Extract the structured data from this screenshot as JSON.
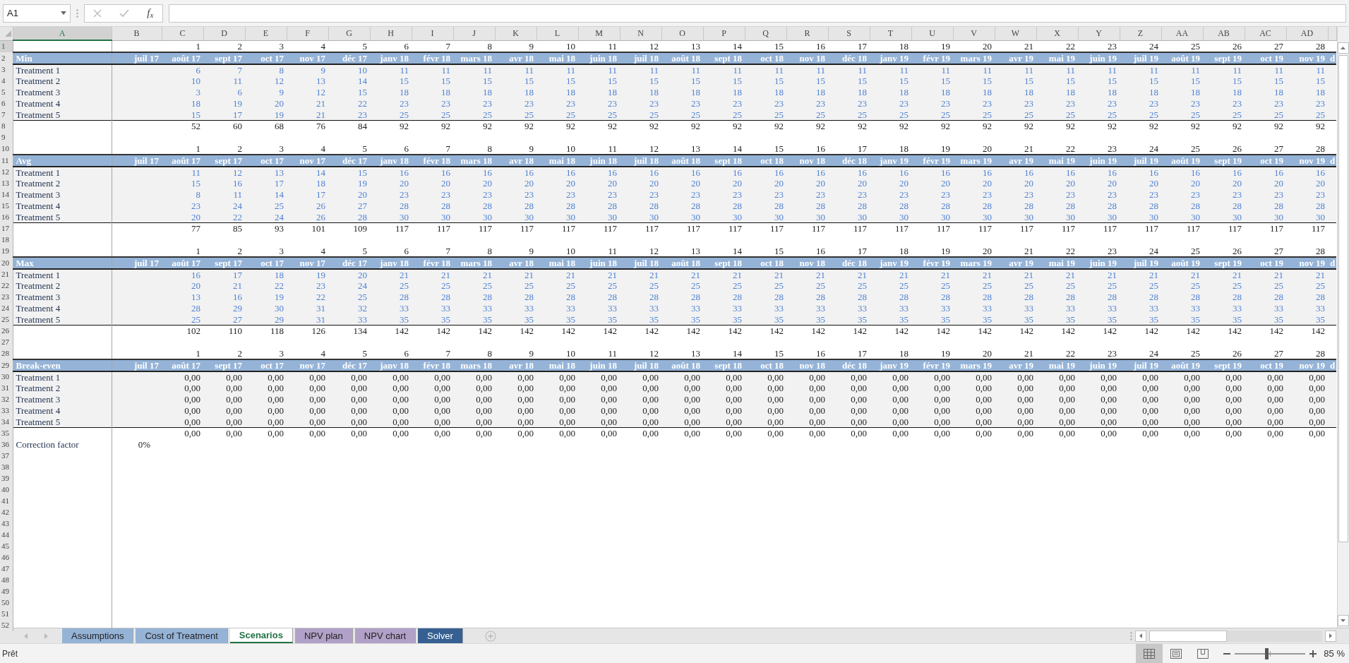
{
  "name_box": {
    "value": "A1"
  },
  "formula_bar": {
    "function_label": "f$_{x}$"
  },
  "column_headers": [
    {
      "label": "A",
      "selected": true
    },
    {
      "label": "B",
      "selected": false
    },
    {
      "label": "C",
      "selected": false
    },
    {
      "label": "D",
      "selected": false
    },
    {
      "label": "E",
      "selected": false
    },
    {
      "label": "F",
      "selected": false
    },
    {
      "label": "G",
      "selected": false
    },
    {
      "label": "H",
      "selected": false
    },
    {
      "label": "I",
      "selected": false
    },
    {
      "label": "J",
      "selected": false
    },
    {
      "label": "K",
      "selected": false
    },
    {
      "label": "L",
      "selected": false
    },
    {
      "label": "M",
      "selected": false
    },
    {
      "label": "N",
      "selected": false
    },
    {
      "label": "O",
      "selected": false
    },
    {
      "label": "P",
      "selected": false
    },
    {
      "label": "Q",
      "selected": false
    },
    {
      "label": "R",
      "selected": false
    },
    {
      "label": "S",
      "selected": false
    },
    {
      "label": "T",
      "selected": false
    },
    {
      "label": "U",
      "selected": false
    },
    {
      "label": "V",
      "selected": false
    },
    {
      "label": "W",
      "selected": false
    },
    {
      "label": "X",
      "selected": false
    },
    {
      "label": "Y",
      "selected": false
    },
    {
      "label": "Z",
      "selected": false
    },
    {
      "label": "AA",
      "selected": false
    },
    {
      "label": "AB",
      "selected": false
    },
    {
      "label": "AC",
      "selected": false
    },
    {
      "label": "AD",
      "selected": false
    }
  ],
  "row_headers": [
    {
      "label": "1",
      "selected": true
    },
    {
      "label": "2",
      "selected": false
    },
    {
      "label": "3",
      "selected": false
    },
    {
      "label": "4",
      "selected": false
    },
    {
      "label": "5",
      "selected": false
    },
    {
      "label": "6",
      "selected": false
    },
    {
      "label": "7",
      "selected": false
    },
    {
      "label": "8",
      "selected": false
    },
    {
      "label": "9",
      "selected": false
    },
    {
      "label": "10",
      "selected": false
    },
    {
      "label": "11",
      "selected": false
    },
    {
      "label": "12",
      "selected": false
    },
    {
      "label": "13",
      "selected": false
    },
    {
      "label": "14",
      "selected": false
    },
    {
      "label": "15",
      "selected": false
    },
    {
      "label": "16",
      "selected": false
    },
    {
      "label": "17",
      "selected": false
    },
    {
      "label": "18",
      "selected": false
    },
    {
      "label": "19",
      "selected": false
    },
    {
      "label": "20",
      "selected": false
    },
    {
      "label": "21",
      "selected": false
    },
    {
      "label": "22",
      "selected": false
    },
    {
      "label": "23",
      "selected": false
    },
    {
      "label": "24",
      "selected": false
    },
    {
      "label": "25",
      "selected": false
    },
    {
      "label": "26",
      "selected": false
    },
    {
      "label": "27",
      "selected": false
    },
    {
      "label": "28",
      "selected": false
    },
    {
      "label": "29",
      "selected": false
    },
    {
      "label": "30",
      "selected": false
    },
    {
      "label": "31",
      "selected": false
    },
    {
      "label": "32",
      "selected": false
    },
    {
      "label": "33",
      "selected": false
    },
    {
      "label": "34",
      "selected": false
    },
    {
      "label": "35",
      "selected": false
    },
    {
      "label": "36",
      "selected": false
    },
    {
      "label": "37",
      "selected": false
    },
    {
      "label": "38",
      "selected": false
    },
    {
      "label": "39",
      "selected": false
    },
    {
      "label": "40",
      "selected": false
    },
    {
      "label": "41",
      "selected": false
    },
    {
      "label": "42",
      "selected": false
    },
    {
      "label": "43",
      "selected": false
    },
    {
      "label": "44",
      "selected": false
    },
    {
      "label": "45",
      "selected": false
    },
    {
      "label": "46",
      "selected": false
    },
    {
      "label": "47",
      "selected": false
    },
    {
      "label": "48",
      "selected": false
    },
    {
      "label": "49",
      "selected": false
    },
    {
      "label": "50",
      "selected": false
    },
    {
      "label": "51",
      "selected": false
    },
    {
      "label": "52",
      "selected": false
    }
  ],
  "blocks": [
    {
      "label": "Min",
      "kind": "input",
      "index": [
        "1",
        "2",
        "3",
        "4",
        "5",
        "6",
        "7",
        "8",
        "9",
        "10",
        "11",
        "12",
        "13",
        "14",
        "15",
        "16",
        "17",
        "18",
        "19",
        "20",
        "21",
        "22",
        "23",
        "24",
        "25",
        "26",
        "27",
        "28"
      ],
      "months": [
        "juil 17",
        "août 17",
        "sept 17",
        "oct 17",
        "nov 17",
        "déc 17",
        "janv 18",
        "févr 18",
        "mars 18",
        "avr 18",
        "mai 18",
        "juin 18",
        "juil 18",
        "août 18",
        "sept 18",
        "oct 18",
        "nov 18",
        "déc 18",
        "janv 19",
        "févr 19",
        "mars 19",
        "avr 19",
        "mai 19",
        "juin 19",
        "juil 19",
        "août 19",
        "sept 19",
        "oct 19",
        "nov 19",
        "d"
      ],
      "rows": [
        {
          "label": "Treatment 1",
          "values": [
            "6",
            "7",
            "8",
            "9",
            "10",
            "11",
            "11",
            "11",
            "11",
            "11",
            "11",
            "11",
            "11",
            "11",
            "11",
            "11",
            "11",
            "11",
            "11",
            "11",
            "11",
            "11",
            "11",
            "11",
            "11",
            "11",
            "11",
            "11"
          ]
        },
        {
          "label": "Treatment 2",
          "values": [
            "10",
            "11",
            "12",
            "13",
            "14",
            "15",
            "15",
            "15",
            "15",
            "15",
            "15",
            "15",
            "15",
            "15",
            "15",
            "15",
            "15",
            "15",
            "15",
            "15",
            "15",
            "15",
            "15",
            "15",
            "15",
            "15",
            "15",
            "15"
          ]
        },
        {
          "label": "Treatment 3",
          "values": [
            "3",
            "6",
            "9",
            "12",
            "15",
            "18",
            "18",
            "18",
            "18",
            "18",
            "18",
            "18",
            "18",
            "18",
            "18",
            "18",
            "18",
            "18",
            "18",
            "18",
            "18",
            "18",
            "18",
            "18",
            "18",
            "18",
            "18",
            "18"
          ]
        },
        {
          "label": "Treatment 4",
          "values": [
            "18",
            "19",
            "20",
            "21",
            "22",
            "23",
            "23",
            "23",
            "23",
            "23",
            "23",
            "23",
            "23",
            "23",
            "23",
            "23",
            "23",
            "23",
            "23",
            "23",
            "23",
            "23",
            "23",
            "23",
            "23",
            "23",
            "23",
            "23"
          ]
        },
        {
          "label": "Treatment 5",
          "values": [
            "15",
            "17",
            "19",
            "21",
            "23",
            "25",
            "25",
            "25",
            "25",
            "25",
            "25",
            "25",
            "25",
            "25",
            "25",
            "25",
            "25",
            "25",
            "25",
            "25",
            "25",
            "25",
            "25",
            "25",
            "25",
            "25",
            "25",
            "25"
          ]
        }
      ],
      "total": [
        "52",
        "60",
        "68",
        "76",
        "84",
        "92",
        "92",
        "92",
        "92",
        "92",
        "92",
        "92",
        "92",
        "92",
        "92",
        "92",
        "92",
        "92",
        "92",
        "92",
        "92",
        "92",
        "92",
        "92",
        "92",
        "92",
        "92",
        "92"
      ]
    },
    {
      "label": "Avg",
      "kind": "input",
      "index": [
        "1",
        "2",
        "3",
        "4",
        "5",
        "6",
        "7",
        "8",
        "9",
        "10",
        "11",
        "12",
        "13",
        "14",
        "15",
        "16",
        "17",
        "18",
        "19",
        "20",
        "21",
        "22",
        "23",
        "24",
        "25",
        "26",
        "27",
        "28"
      ],
      "months": [
        "juil 17",
        "août 17",
        "sept 17",
        "oct 17",
        "nov 17",
        "déc 17",
        "janv 18",
        "févr 18",
        "mars 18",
        "avr 18",
        "mai 18",
        "juin 18",
        "juil 18",
        "août 18",
        "sept 18",
        "oct 18",
        "nov 18",
        "déc 18",
        "janv 19",
        "févr 19",
        "mars 19",
        "avr 19",
        "mai 19",
        "juin 19",
        "juil 19",
        "août 19",
        "sept 19",
        "oct 19",
        "nov 19",
        "d"
      ],
      "rows": [
        {
          "label": "Treatment 1",
          "values": [
            "11",
            "12",
            "13",
            "14",
            "15",
            "16",
            "16",
            "16",
            "16",
            "16",
            "16",
            "16",
            "16",
            "16",
            "16",
            "16",
            "16",
            "16",
            "16",
            "16",
            "16",
            "16",
            "16",
            "16",
            "16",
            "16",
            "16",
            "16"
          ]
        },
        {
          "label": "Treatment 2",
          "values": [
            "15",
            "16",
            "17",
            "18",
            "19",
            "20",
            "20",
            "20",
            "20",
            "20",
            "20",
            "20",
            "20",
            "20",
            "20",
            "20",
            "20",
            "20",
            "20",
            "20",
            "20",
            "20",
            "20",
            "20",
            "20",
            "20",
            "20",
            "20"
          ]
        },
        {
          "label": "Treatment 3",
          "values": [
            "8",
            "11",
            "14",
            "17",
            "20",
            "23",
            "23",
            "23",
            "23",
            "23",
            "23",
            "23",
            "23",
            "23",
            "23",
            "23",
            "23",
            "23",
            "23",
            "23",
            "23",
            "23",
            "23",
            "23",
            "23",
            "23",
            "23",
            "23"
          ]
        },
        {
          "label": "Treatment 4",
          "values": [
            "23",
            "24",
            "25",
            "26",
            "27",
            "28",
            "28",
            "28",
            "28",
            "28",
            "28",
            "28",
            "28",
            "28",
            "28",
            "28",
            "28",
            "28",
            "28",
            "28",
            "28",
            "28",
            "28",
            "28",
            "28",
            "28",
            "28",
            "28"
          ]
        },
        {
          "label": "Treatment 5",
          "values": [
            "20",
            "22",
            "24",
            "26",
            "28",
            "30",
            "30",
            "30",
            "30",
            "30",
            "30",
            "30",
            "30",
            "30",
            "30",
            "30",
            "30",
            "30",
            "30",
            "30",
            "30",
            "30",
            "30",
            "30",
            "30",
            "30",
            "30",
            "30"
          ]
        }
      ],
      "total": [
        "77",
        "85",
        "93",
        "101",
        "109",
        "117",
        "117",
        "117",
        "117",
        "117",
        "117",
        "117",
        "117",
        "117",
        "117",
        "117",
        "117",
        "117",
        "117",
        "117",
        "117",
        "117",
        "117",
        "117",
        "117",
        "117",
        "117",
        "117"
      ]
    },
    {
      "label": "Max",
      "kind": "input",
      "index": [
        "1",
        "2",
        "3",
        "4",
        "5",
        "6",
        "7",
        "8",
        "9",
        "10",
        "11",
        "12",
        "13",
        "14",
        "15",
        "16",
        "17",
        "18",
        "19",
        "20",
        "21",
        "22",
        "23",
        "24",
        "25",
        "26",
        "27",
        "28"
      ],
      "months": [
        "juil 17",
        "août 17",
        "sept 17",
        "oct 17",
        "nov 17",
        "déc 17",
        "janv 18",
        "févr 18",
        "mars 18",
        "avr 18",
        "mai 18",
        "juin 18",
        "juil 18",
        "août 18",
        "sept 18",
        "oct 18",
        "nov 18",
        "déc 18",
        "janv 19",
        "févr 19",
        "mars 19",
        "avr 19",
        "mai 19",
        "juin 19",
        "juil 19",
        "août 19",
        "sept 19",
        "oct 19",
        "nov 19",
        "d"
      ],
      "rows": [
        {
          "label": "Treatment 1",
          "values": [
            "16",
            "17",
            "18",
            "19",
            "20",
            "21",
            "21",
            "21",
            "21",
            "21",
            "21",
            "21",
            "21",
            "21",
            "21",
            "21",
            "21",
            "21",
            "21",
            "21",
            "21",
            "21",
            "21",
            "21",
            "21",
            "21",
            "21",
            "21"
          ]
        },
        {
          "label": "Treatment 2",
          "values": [
            "20",
            "21",
            "22",
            "23",
            "24",
            "25",
            "25",
            "25",
            "25",
            "25",
            "25",
            "25",
            "25",
            "25",
            "25",
            "25",
            "25",
            "25",
            "25",
            "25",
            "25",
            "25",
            "25",
            "25",
            "25",
            "25",
            "25",
            "25"
          ]
        },
        {
          "label": "Treatment 3",
          "values": [
            "13",
            "16",
            "19",
            "22",
            "25",
            "28",
            "28",
            "28",
            "28",
            "28",
            "28",
            "28",
            "28",
            "28",
            "28",
            "28",
            "28",
            "28",
            "28",
            "28",
            "28",
            "28",
            "28",
            "28",
            "28",
            "28",
            "28",
            "28"
          ]
        },
        {
          "label": "Treatment 4",
          "values": [
            "28",
            "29",
            "30",
            "31",
            "32",
            "33",
            "33",
            "33",
            "33",
            "33",
            "33",
            "33",
            "33",
            "33",
            "33",
            "33",
            "33",
            "33",
            "33",
            "33",
            "33",
            "33",
            "33",
            "33",
            "33",
            "33",
            "33",
            "33"
          ]
        },
        {
          "label": "Treatment 5",
          "values": [
            "25",
            "27",
            "29",
            "31",
            "33",
            "35",
            "35",
            "35",
            "35",
            "35",
            "35",
            "35",
            "35",
            "35",
            "35",
            "35",
            "35",
            "35",
            "35",
            "35",
            "35",
            "35",
            "35",
            "35",
            "35",
            "35",
            "35",
            "35"
          ]
        }
      ],
      "total": [
        "102",
        "110",
        "118",
        "126",
        "134",
        "142",
        "142",
        "142",
        "142",
        "142",
        "142",
        "142",
        "142",
        "142",
        "142",
        "142",
        "142",
        "142",
        "142",
        "142",
        "142",
        "142",
        "142",
        "142",
        "142",
        "142",
        "142",
        "142"
      ]
    },
    {
      "label": "Break-even",
      "kind": "formula",
      "index": [
        "1",
        "2",
        "3",
        "4",
        "5",
        "6",
        "7",
        "8",
        "9",
        "10",
        "11",
        "12",
        "13",
        "14",
        "15",
        "16",
        "17",
        "18",
        "19",
        "20",
        "21",
        "22",
        "23",
        "24",
        "25",
        "26",
        "27",
        "28"
      ],
      "months": [
        "juil 17",
        "août 17",
        "sept 17",
        "oct 17",
        "nov 17",
        "déc 17",
        "janv 18",
        "févr 18",
        "mars 18",
        "avr 18",
        "mai 18",
        "juin 18",
        "juil 18",
        "août 18",
        "sept 18",
        "oct 18",
        "nov 18",
        "déc 18",
        "janv 19",
        "févr 19",
        "mars 19",
        "avr 19",
        "mai 19",
        "juin 19",
        "juil 19",
        "août 19",
        "sept 19",
        "oct 19",
        "nov 19",
        "d"
      ],
      "rows": [
        {
          "label": "Treatment 1",
          "values": [
            "0,00",
            "0,00",
            "0,00",
            "0,00",
            "0,00",
            "0,00",
            "0,00",
            "0,00",
            "0,00",
            "0,00",
            "0,00",
            "0,00",
            "0,00",
            "0,00",
            "0,00",
            "0,00",
            "0,00",
            "0,00",
            "0,00",
            "0,00",
            "0,00",
            "0,00",
            "0,00",
            "0,00",
            "0,00",
            "0,00",
            "0,00",
            "0,00"
          ]
        },
        {
          "label": "Treatment 2",
          "values": [
            "0,00",
            "0,00",
            "0,00",
            "0,00",
            "0,00",
            "0,00",
            "0,00",
            "0,00",
            "0,00",
            "0,00",
            "0,00",
            "0,00",
            "0,00",
            "0,00",
            "0,00",
            "0,00",
            "0,00",
            "0,00",
            "0,00",
            "0,00",
            "0,00",
            "0,00",
            "0,00",
            "0,00",
            "0,00",
            "0,00",
            "0,00",
            "0,00"
          ]
        },
        {
          "label": "Treatment 3",
          "values": [
            "0,00",
            "0,00",
            "0,00",
            "0,00",
            "0,00",
            "0,00",
            "0,00",
            "0,00",
            "0,00",
            "0,00",
            "0,00",
            "0,00",
            "0,00",
            "0,00",
            "0,00",
            "0,00",
            "0,00",
            "0,00",
            "0,00",
            "0,00",
            "0,00",
            "0,00",
            "0,00",
            "0,00",
            "0,00",
            "0,00",
            "0,00",
            "0,00"
          ]
        },
        {
          "label": "Treatment 4",
          "values": [
            "0,00",
            "0,00",
            "0,00",
            "0,00",
            "0,00",
            "0,00",
            "0,00",
            "0,00",
            "0,00",
            "0,00",
            "0,00",
            "0,00",
            "0,00",
            "0,00",
            "0,00",
            "0,00",
            "0,00",
            "0,00",
            "0,00",
            "0,00",
            "0,00",
            "0,00",
            "0,00",
            "0,00",
            "0,00",
            "0,00",
            "0,00",
            "0,00"
          ]
        },
        {
          "label": "Treatment 5",
          "values": [
            "0,00",
            "0,00",
            "0,00",
            "0,00",
            "0,00",
            "0,00",
            "0,00",
            "0,00",
            "0,00",
            "0,00",
            "0,00",
            "0,00",
            "0,00",
            "0,00",
            "0,00",
            "0,00",
            "0,00",
            "0,00",
            "0,00",
            "0,00",
            "0,00",
            "0,00",
            "0,00",
            "0,00",
            "0,00",
            "0,00",
            "0,00",
            "0,00"
          ]
        }
      ],
      "total": [
        "0,00",
        "0,00",
        "0,00",
        "0,00",
        "0,00",
        "0,00",
        "0,00",
        "0,00",
        "0,00",
        "0,00",
        "0,00",
        "0,00",
        "0,00",
        "0,00",
        "0,00",
        "0,00",
        "0,00",
        "0,00",
        "0,00",
        "0,00",
        "0,00",
        "0,00",
        "0,00",
        "0,00",
        "0,00",
        "0,00",
        "0,00",
        "0,00"
      ]
    }
  ],
  "correction_factor": {
    "label": "Correction factor",
    "value": "0%"
  },
  "sheet_tabs": [
    {
      "label": "Assumptions",
      "color": "#95b3d7",
      "selected": false
    },
    {
      "label": "Cost of Treatment",
      "color": "#95b3d7",
      "selected": false
    },
    {
      "label": "Scenarios",
      "selected": true
    },
    {
      "label": "NPV plan",
      "color": "#b1a0c7",
      "selected": false
    },
    {
      "label": "NPV chart",
      "color": "#b1a0c7",
      "selected": false
    },
    {
      "label": "Solver",
      "color": "#366092",
      "selected": false
    }
  ],
  "status_bar": {
    "text": "Prêt",
    "views": [
      {
        "kind": "normal",
        "selected": true
      },
      {
        "kind": "page-layout",
        "selected": false
      },
      {
        "kind": "page-break",
        "selected": false
      }
    ],
    "zoom": {
      "level": 0.45,
      "reading": "85 %"
    }
  }
}
